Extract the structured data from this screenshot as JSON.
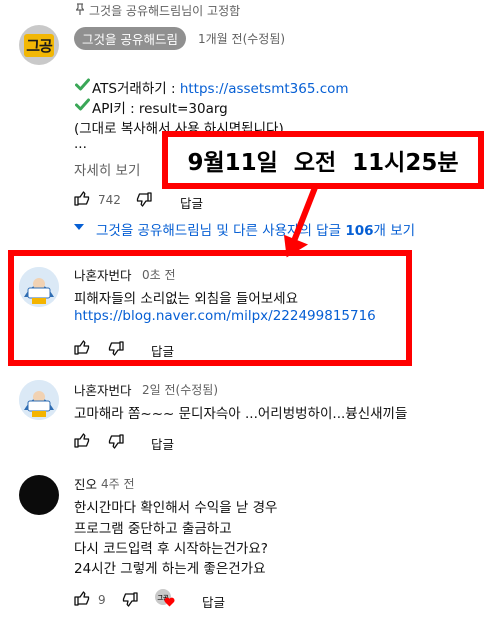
{
  "pinned": {
    "pin_text": "그것을 공유해드림님이 고정함",
    "avatar_text": "그공",
    "author": "그것을 공유해드림",
    "time": "1개월 전(수정됨)",
    "line1_label": "ATS거래하기 : ",
    "line1_link": "https://assetsmt365.com",
    "line2": "API키 : result=30arg",
    "line3": "(그대로 복사해서 사용 하시면됩니다)",
    "line4": "...",
    "read_more": "자세히 보기",
    "likes": "742",
    "reply": "답글",
    "view_replies": "그것을 공유해드림님 및 다른 사용자의 답글 106개 보기"
  },
  "annotation": {
    "banner_text": "9월11일  오전  11시25분"
  },
  "comments": [
    {
      "avatar_text": "나혼자번다",
      "author": "나혼자번다",
      "time": "0초 전",
      "lines": [
        "피해자들의 소리없는 외침을 들어보세요"
      ],
      "link": "https://blog.naver.com/milpx/222499815716",
      "likes": "",
      "reply": "답글"
    },
    {
      "avatar_text": "나혼자번다",
      "author": "나혼자번다",
      "time": "2일 전(수정됨)",
      "lines": [
        "고마해라 쫌~~~ 문디자슥아 ...어리벙벙하이...븅신새끼들"
      ],
      "likes": "",
      "reply": "답글"
    },
    {
      "author": "진오",
      "time": "4주 전",
      "lines": [
        "한시간마다 확인해서 수익을 낟 경우",
        "프로그램 중단하고 출금하고",
        "다시 코드입력 후 시작하는건가요?",
        "24시간 그렇게 하는게 좋은건가요"
      ],
      "likes": "9",
      "creator_heart": "그공",
      "reply": "답글"
    }
  ],
  "colors": {
    "link": "#065fd4",
    "highlight": "#ff0000",
    "check": "#3aa757"
  }
}
